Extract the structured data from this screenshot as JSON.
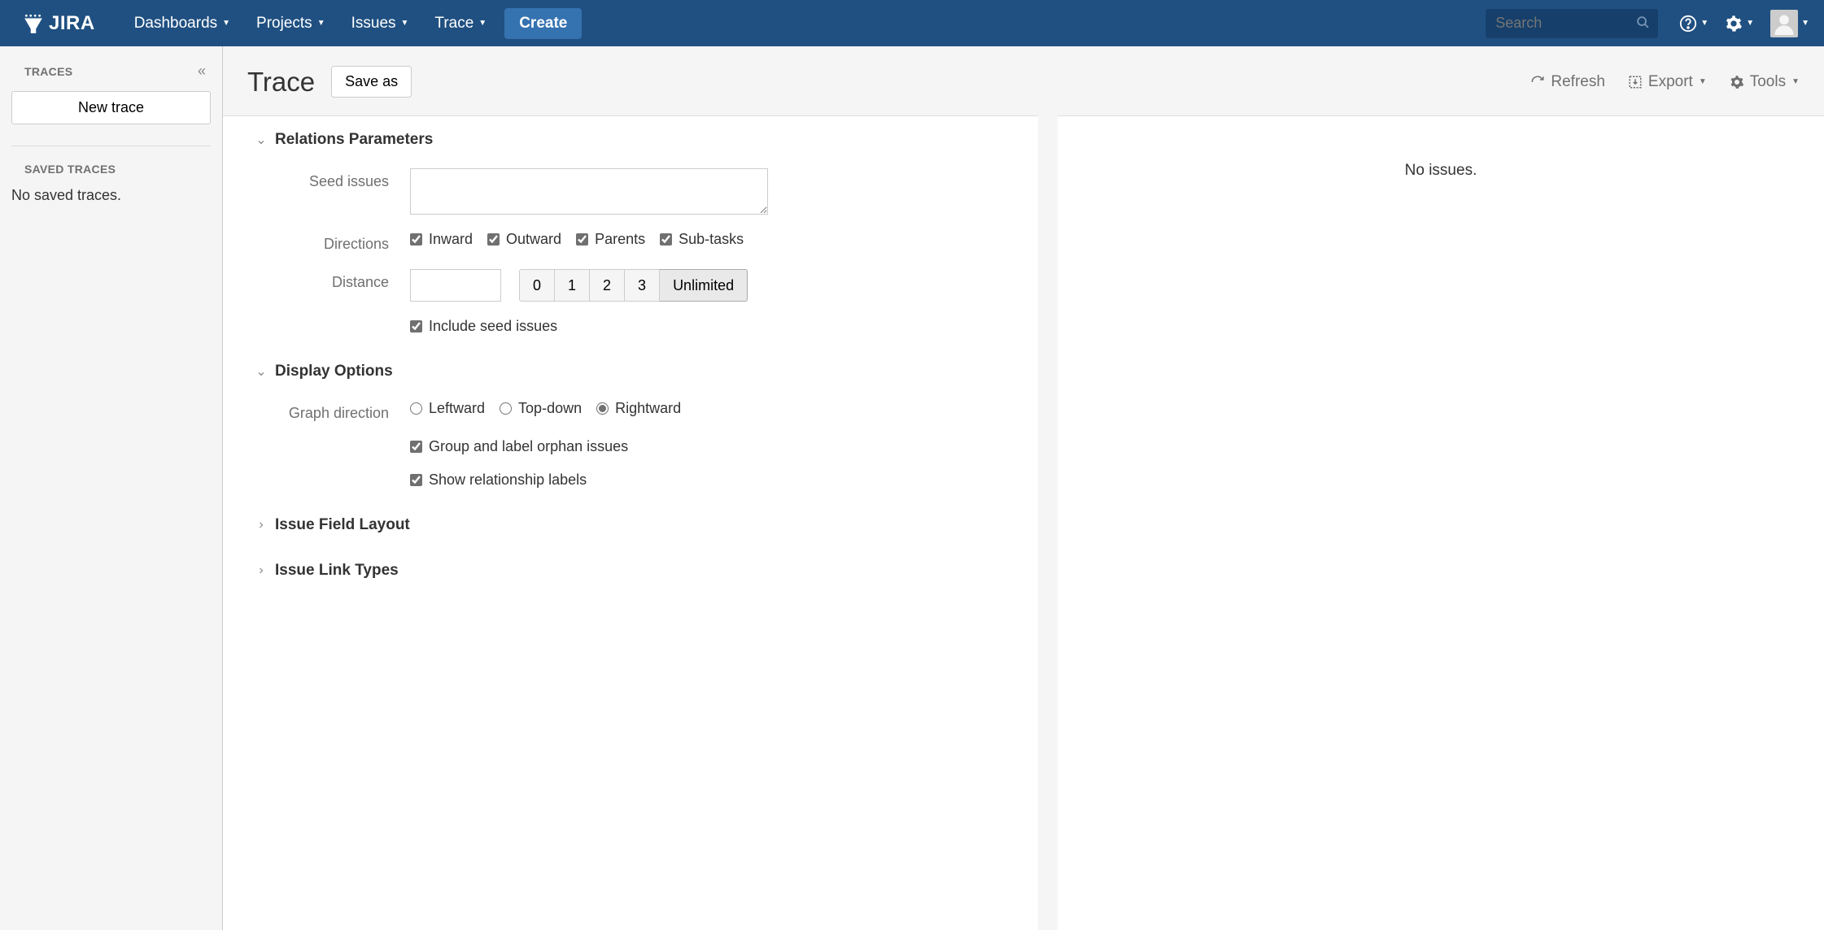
{
  "nav": {
    "logo_text": "JIRA",
    "items": [
      "Dashboards",
      "Projects",
      "Issues",
      "Trace"
    ],
    "create": "Create",
    "search_placeholder": "Search"
  },
  "sidebar": {
    "traces_label": "TRACES",
    "new_trace": "New trace",
    "saved_label": "SAVED TRACES",
    "no_saved": "No saved traces."
  },
  "header": {
    "title": "Trace",
    "save_as": "Save as",
    "refresh": "Refresh",
    "export": "Export",
    "tools": "Tools"
  },
  "sections": {
    "relations": "Relations Parameters",
    "display": "Display Options",
    "layout": "Issue Field Layout",
    "link_types": "Issue Link Types"
  },
  "relations": {
    "seed_label": "Seed issues",
    "seed_value": "",
    "directions_label": "Directions",
    "dir_inward": "Inward",
    "dir_outward": "Outward",
    "dir_parents": "Parents",
    "dir_subtasks": "Sub-tasks",
    "distance_label": "Distance",
    "distance_value": "",
    "dist_0": "0",
    "dist_1": "1",
    "dist_2": "2",
    "dist_3": "3",
    "dist_unlimited": "Unlimited",
    "include_seed": "Include seed issues"
  },
  "display": {
    "graph_dir_label": "Graph direction",
    "leftward": "Leftward",
    "topdown": "Top-down",
    "rightward": "Rightward",
    "group_orphan": "Group and label orphan issues",
    "show_rel": "Show relationship labels"
  },
  "results": {
    "no_issues": "No issues."
  }
}
